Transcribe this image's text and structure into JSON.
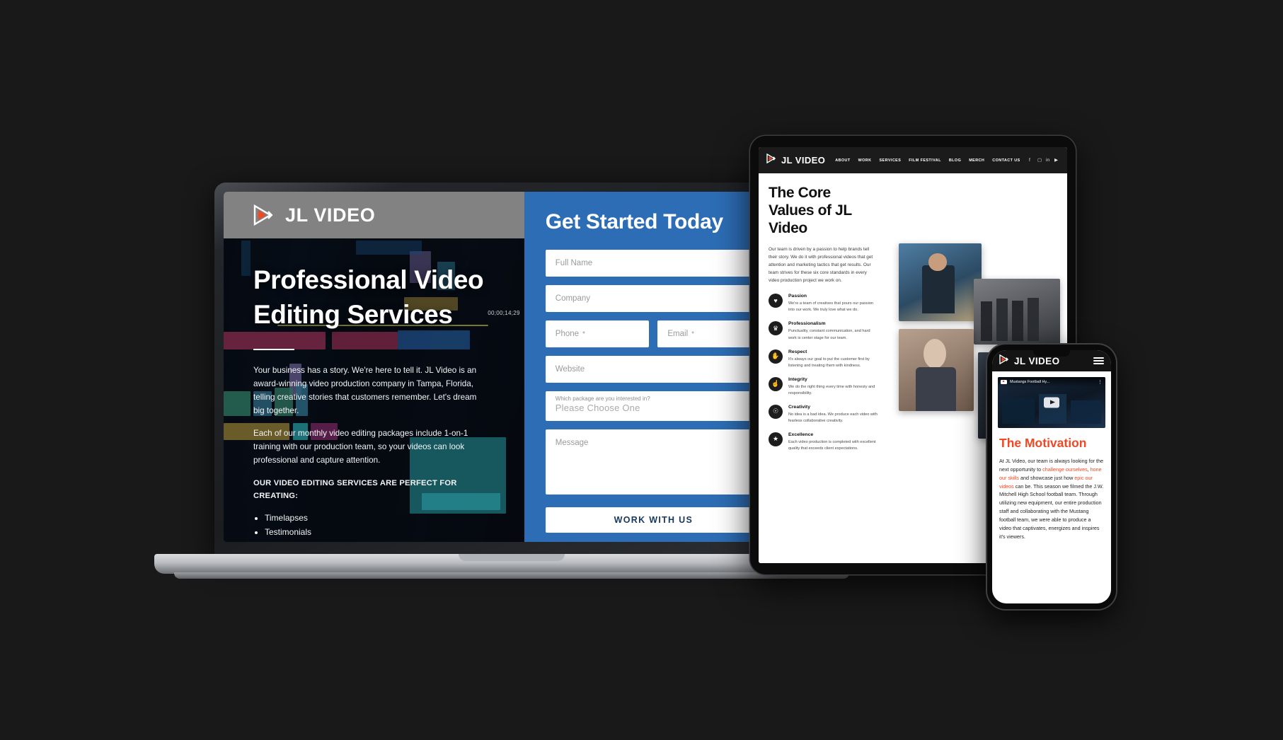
{
  "brand": {
    "name": "JL VIDEO",
    "mark_icon": "play-triangle-icon",
    "accent": "#ef4823"
  },
  "laptop": {
    "hero": {
      "heading": "Professional Video Editing Services",
      "timecode": "00;00;14;29",
      "paragraph1": "Your business has a story. We're here to tell it. JL Video is an award-winning video production company in Tampa, Florida, telling creative stories that customers remember. Let's dream big together.",
      "paragraph2": "Each of our monthly video editing packages include 1-on-1 training with our production team, so your videos can look professional and capture attention.",
      "list_heading": "OUR VIDEO EDITING SERVICES ARE PERFECT FOR CREATING:",
      "list_items": [
        "Timelapses",
        "Testimonials"
      ]
    },
    "form": {
      "title": "Get Started Today",
      "fields": [
        {
          "name": "full-name",
          "placeholder": "Full Name"
        },
        {
          "name": "company",
          "placeholder": "Company"
        },
        {
          "name": "phone",
          "placeholder": "Phone",
          "required_mark": "*"
        },
        {
          "name": "email",
          "placeholder": "Email",
          "required_mark": "*"
        },
        {
          "name": "website",
          "placeholder": "Website"
        }
      ],
      "select": {
        "label": "Which package are you interested in?",
        "value": "Please Choose One",
        "caret_icon": "chevron-down-icon"
      },
      "message_placeholder": "Message",
      "submit_label": "WORK WITH US"
    }
  },
  "tablet": {
    "nav_items": [
      "ABOUT",
      "WORK",
      "SERVICES",
      "FILM FESTIVAL",
      "BLOG",
      "MERCH",
      "CONTACT US"
    ],
    "social_icons": [
      "facebook-icon",
      "instagram-icon",
      "linkedin-icon",
      "youtube-icon"
    ],
    "heading": "The Core Values of JL Video",
    "intro": "Our team is driven by a passion to help brands tell their story. We do it with professional videos that get attention and marketing tactics that get results. Our team strives for these six core standards in every video production project we work on.",
    "values": [
      {
        "icon": "heart-icon",
        "glyph": "♥",
        "title": "Passion",
        "desc": "We're a team of creatives that pours our passion into our work. We truly love what we do."
      },
      {
        "icon": "trophy-icon",
        "glyph": "♛",
        "title": "Professionalism",
        "desc": "Punctuality, constant communication, and hard work is center stage for our team."
      },
      {
        "icon": "handshake-icon",
        "glyph": "✋",
        "title": "Respect",
        "desc": "It's always our goal to put the customer first by listening and treating them with kindness."
      },
      {
        "icon": "thumbs-up-icon",
        "glyph": "☝",
        "title": "Integrity",
        "desc": "We do the right thing every time with honesty and responsibility."
      },
      {
        "icon": "lightbulb-icon",
        "glyph": "☉",
        "title": "Creativity",
        "desc": "No idea is a bad idea. We produce each video with fearless collaborative creativity."
      },
      {
        "icon": "star-icon",
        "glyph": "★",
        "title": "Excellence",
        "desc": "Each video production is completed with excellent quality that exceeds client expectations."
      }
    ],
    "photos": [
      {
        "name": "team-photo-award",
        "colors": [
          "#3e6d93",
          "#c9b48f"
        ]
      },
      {
        "name": "team-photo-group",
        "colors": [
          "#6d6f74",
          "#3b3d42"
        ]
      },
      {
        "name": "team-photo-portrait",
        "colors": [
          "#8d6b58",
          "#d3c2b4"
        ]
      },
      {
        "name": "team-photo-crew",
        "colors": [
          "#2b3440",
          "#5a6472"
        ]
      }
    ]
  },
  "phone": {
    "video": {
      "title": "Mustangs Football Hy...",
      "platform_icon": "youtube-icon",
      "menu_icon": "kebab-menu-icon",
      "play_icon": "play-button-icon"
    },
    "menu_icon": "hamburger-menu-icon",
    "heading": "The Motivation",
    "body_parts": [
      {
        "text": "At JL Video, our team is always looking for the next opportunity to ",
        "hl": false
      },
      {
        "text": "challenge ourselves",
        "hl": true
      },
      {
        "text": ", ",
        "hl": false
      },
      {
        "text": "hone our skills",
        "hl": true
      },
      {
        "text": " and showcase just how ",
        "hl": false
      },
      {
        "text": "epic our videos",
        "hl": true
      },
      {
        "text": " can be. This season we filmed the J.W. Mitchell High School football team. Through utilizing new equipment, our entire production staff and collaborating with the Mustang football team, we were able to produce a video that captivates, energizes and inspires it's viewers.",
        "hl": false
      }
    ]
  }
}
